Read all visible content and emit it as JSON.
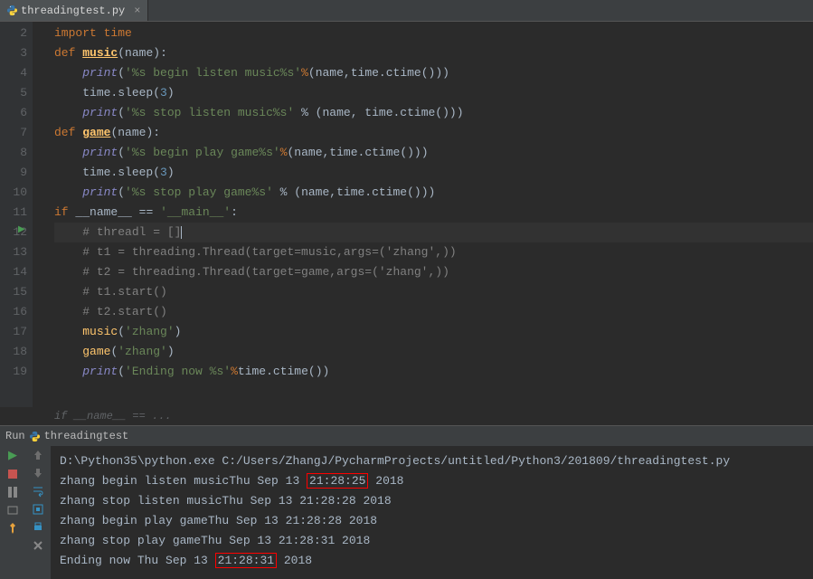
{
  "tab": {
    "label": "threadingtest.py"
  },
  "lines": {
    "l2": "import time",
    "l3_def": "def",
    "l3_fn": "music",
    "l3_param": "name",
    "l4_print": "print",
    "l4_str": "'%s begin listen music%s'",
    "l4_op": "%",
    "l4_args": "(name,time.ctime())",
    "l5_time": "time.sleep(",
    "l5_num": "3",
    "l6_print": "print",
    "l6_str": "'%s stop listen music%s'",
    "l6_rest": " % (name, time.ctime())",
    "l7_def": "def",
    "l7_fn": "game",
    "l7_param": "name",
    "l8_print": "print",
    "l8_str": "'%s begin play game%s'",
    "l8_op": "%",
    "l8_args": "(name,time.ctime())",
    "l9_time": "time.sleep(",
    "l9_num": "3",
    "l10_print": "print",
    "l10_str": "'%s stop play game%s'",
    "l10_rest": " % (name,time.ctime())",
    "l11_if": "if",
    "l11_name": "__name__",
    "l11_eq": " == ",
    "l11_main": "'__main__'",
    "l12": "# threadl = []",
    "l13": "# t1 = threading.Thread(target=music,args=('zhang',))",
    "l14": "# t2 = threading.Thread(target=game,args=('zhang',))",
    "l15": "# t1.start()",
    "l16": "# t2.start()",
    "l17_fn": "music",
    "l17_arg": "'zhang'",
    "l18_fn": "game",
    "l18_arg": "'zhang'",
    "l19_print": "print",
    "l19_str": "'Ending now %s'",
    "l19_op": "%",
    "l19_rest": "time.ctime()"
  },
  "breadcrumb": "if __name__ == ...",
  "run": {
    "label": "Run",
    "name": "threadingtest",
    "console": {
      "cmd": "D:\\Python35\\python.exe C:/Users/ZhangJ/PycharmProjects/untitled/Python3/201809/threadingtest.py",
      "l1a": "zhang begin listen musicThu Sep 13 ",
      "l1box": "21:28:25",
      "l1b": " 2018",
      "l2": "zhang stop listen musicThu Sep 13 21:28:28 2018",
      "l3": "zhang begin play gameThu Sep 13 21:28:28 2018",
      "l4": "zhang stop play gameThu Sep 13 21:28:31 2018",
      "l5a": "Ending now Thu Sep 13 ",
      "l5box": "21:28:31",
      "l5b": " 2018"
    }
  }
}
